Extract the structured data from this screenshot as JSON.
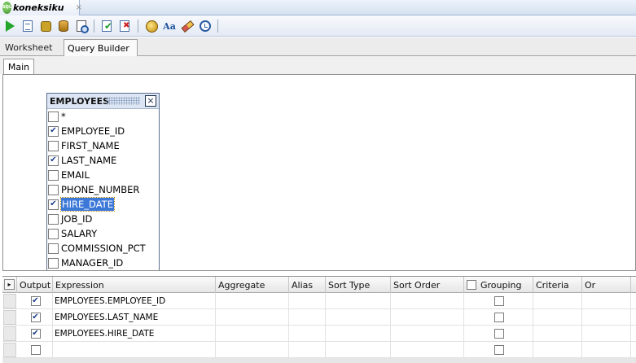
{
  "doc_tab": {
    "label": "koneksiku",
    "close": "×",
    "icon_text": "SQL"
  },
  "toolbar": {
    "icons": [
      "run-statement-icon",
      "run-script-icon",
      "autotrace-icon",
      "explain-plan-icon",
      "sql-tuning-icon",
      "commit-icon",
      "rollback-icon",
      "cancel-icon",
      "to-upper-lower-icon",
      "clear-icon",
      "sql-history-icon"
    ]
  },
  "subtabs": {
    "worksheet": "Worksheet",
    "query_builder": "Query Builder"
  },
  "main_tab": "Main",
  "table_box": {
    "title": "EMPLOYEES",
    "close": "☒",
    "columns": [
      {
        "label": "*",
        "checked": false
      },
      {
        "label": "EMPLOYEE_ID",
        "checked": true
      },
      {
        "label": "FIRST_NAME",
        "checked": false
      },
      {
        "label": "LAST_NAME",
        "checked": true
      },
      {
        "label": "EMAIL",
        "checked": false
      },
      {
        "label": "PHONE_NUMBER",
        "checked": false
      },
      {
        "label": "HIRE_DATE",
        "checked": true,
        "selected": true
      },
      {
        "label": "JOB_ID",
        "checked": false
      },
      {
        "label": "SALARY",
        "checked": false
      },
      {
        "label": "COMMISSION_PCT",
        "checked": false
      },
      {
        "label": "MANAGER_ID",
        "checked": false
      }
    ]
  },
  "grid": {
    "expand_symbol": "▸",
    "headers": {
      "output": "Output",
      "expression": "Expression",
      "aggregate": "Aggregate",
      "alias": "Alias",
      "sort_type": "Sort Type",
      "sort_order": "Sort Order",
      "grouping": "Grouping",
      "criteria": "Criteria",
      "or": "Or"
    },
    "rows": [
      {
        "output": true,
        "expression": "EMPLOYEES.EMPLOYEE_ID",
        "grouping": false
      },
      {
        "output": true,
        "expression": "EMPLOYEES.LAST_NAME",
        "grouping": false
      },
      {
        "output": true,
        "expression": "EMPLOYEES.HIRE_DATE",
        "grouping": false
      },
      {
        "output": false,
        "expression": "",
        "grouping": false
      }
    ]
  },
  "colors": {
    "selection": "#3c78d8",
    "check": "#1b3d8a",
    "table_header": "#dce5f3"
  }
}
